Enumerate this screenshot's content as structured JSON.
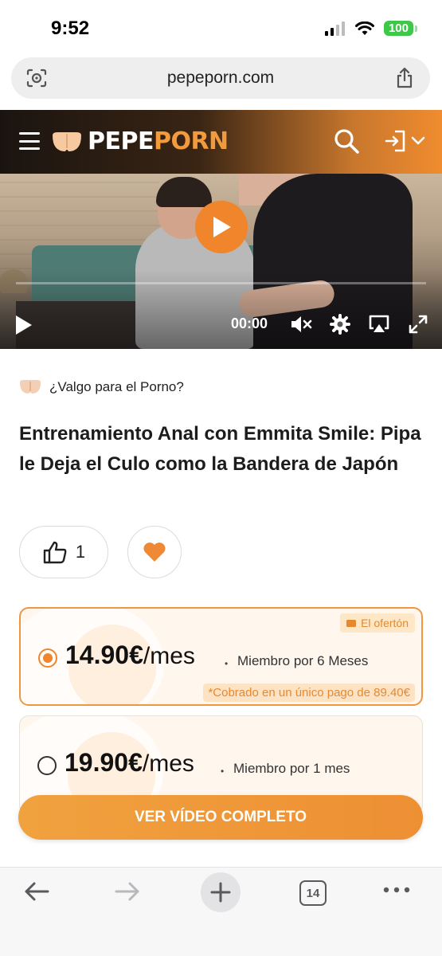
{
  "status": {
    "time": "9:52",
    "battery": "100"
  },
  "browser": {
    "url": "pepeporn.com"
  },
  "site": {
    "logo_part1": "PEPE",
    "logo_part2": "PORN"
  },
  "video": {
    "time": "00:00"
  },
  "content": {
    "category": "¿Valgo para el Porno?",
    "title": "Entrenamiento Anal con Emmita Smile: Pipa le Deja el Culo como la Bandera de Japón",
    "likes": "1"
  },
  "plans": [
    {
      "price": "14.90€",
      "unit": "/mes",
      "description": "Miembro por 6 Meses",
      "badge": "El ofertón",
      "note": "*Cobrado en un único pago de 89.40€",
      "selected": true
    },
    {
      "price": "19.90€",
      "unit": "/mes",
      "description": "Miembro por 1 mes",
      "selected": false
    }
  ],
  "cta": {
    "label": "VER VÍDEO COMPLETO"
  },
  "toolbar": {
    "tab_count": "14"
  },
  "colors": {
    "accent": "#f0852b",
    "header_dark": "#1a1410"
  }
}
